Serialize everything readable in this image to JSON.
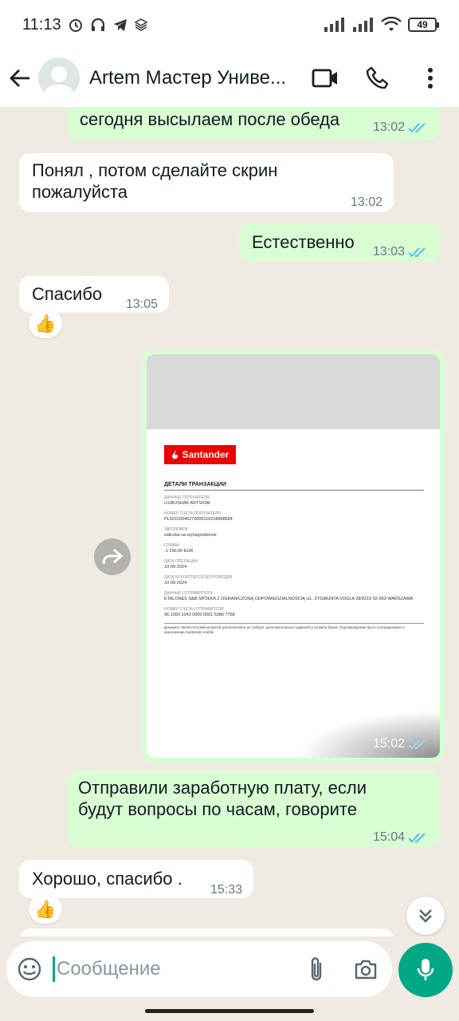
{
  "status_bar": {
    "time": "11:13",
    "battery": "49"
  },
  "header": {
    "contact_name": "Artem Мастер Униве..."
  },
  "messages": [
    {
      "dir": "out",
      "text": "сегодня высылаем после обеда",
      "time": "13:02"
    },
    {
      "dir": "in",
      "text": "Понял , потом  сделайте скрин пожалуйста",
      "time": "13:02"
    },
    {
      "dir": "out",
      "text": "Естественно",
      "time": "13:03"
    },
    {
      "dir": "in",
      "text": "Спасибо",
      "time": "13:05",
      "reaction": "👍"
    },
    {
      "dir": "out",
      "type": "image",
      "time": "15:02"
    },
    {
      "dir": "out",
      "text": "Отправили заработную плату, если будут вопросы по часам, говорите",
      "time": "15:04"
    },
    {
      "dir": "in",
      "text": "Хорошо, спасибо .",
      "time": "15:33",
      "reaction": "👍"
    }
  ],
  "image_doc": {
    "logo": "Santander",
    "title": "ДЕТАЛИ ТРАНЗАКЦИИ",
    "rows": [
      {
        "label": "ДАННЫЕ ПОЛУЧАТЕЛЯ",
        "value": "LIUBUSHAK ARTSIOM"
      },
      {
        "label": "НОМЕР СЧЕТА ПОЛУЧАТЕЛЯ",
        "value": "PL60102040270000110218898684"
      },
      {
        "label": "ЗАГОЛОВОК",
        "value": "zaliczka na wynagrodzenie"
      },
      {
        "label": "СУММА",
        "value": "-1 290,00 EUR"
      },
      {
        "label": "ДАТА ОПЕРАЦИИ",
        "value": "10-09-2024"
      },
      {
        "label": "ДАТА БУХГАЛТЕРСКОЙ ПРОВОДКИ",
        "value": "10-09-2024"
      },
      {
        "label": "ДАННЫЕ ОТПРАВИТЕЛЯ",
        "value": "ETALONES S&B SPÓŁKA Z OGRANICZONĄ ODPOWIEDZIALNOŚCIĄ UL. ZYGMUNTA VOGLA 28/0219 02-963 WARSZAWA"
      },
      {
        "label": "НОМЕР СЧЕТА ОТПРАВИТЕЛЯ",
        "value": "36 1090 1043 0000 0001 5380 7768"
      }
    ],
    "footer": "Документ является компьютерной распечаткой и не требует дополнительных подписей и штампа банка. Подтверждение было сгенерировано в приложении Santander mobile."
  },
  "input": {
    "placeholder": "Сообщение"
  },
  "colors": {
    "accent": "#00a884",
    "outgoing": "#d9fdd3",
    "incoming": "#ffffff",
    "tick": "#53bdeb"
  }
}
